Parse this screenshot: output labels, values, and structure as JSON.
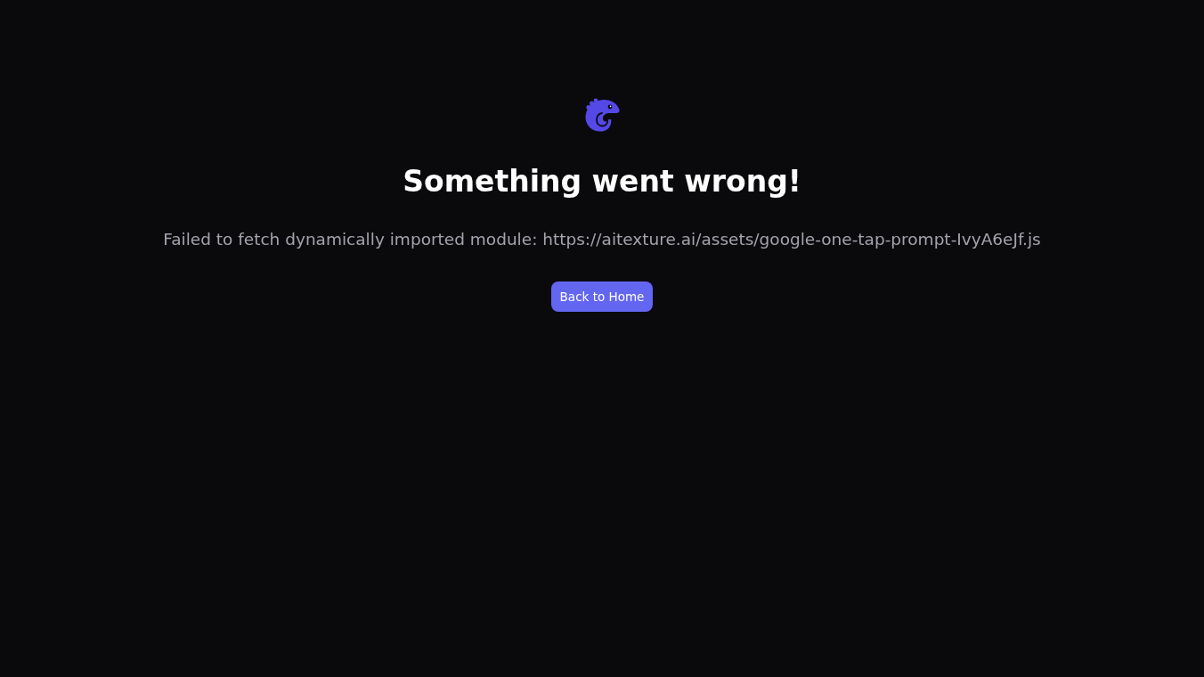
{
  "title": "Something went wrong!",
  "message": "Failed to fetch dynamically imported module: https://aitexture.ai/assets/google-one-tap-prompt-IvyA6eJf.js",
  "button": {
    "label": "Back to Home"
  }
}
